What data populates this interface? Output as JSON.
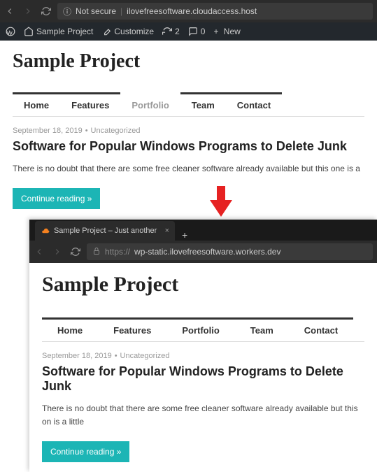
{
  "top": {
    "addressbar": {
      "security_label": "Not secure",
      "url": "ilovefreesoftware.cloudaccess.host"
    },
    "wpbar": {
      "site_name": "Sample Project",
      "customize": "Customize",
      "updates": "2",
      "comments": "0",
      "new": "New"
    },
    "site_title": "Sample Project",
    "nav": [
      {
        "label": "Home",
        "active": true
      },
      {
        "label": "Features",
        "active": true
      },
      {
        "label": "Portfolio",
        "active": false
      },
      {
        "label": "Team",
        "active": true
      },
      {
        "label": "Contact",
        "active": true
      }
    ],
    "post": {
      "date": "September 18, 2019",
      "category": "Uncategorized",
      "title": "Software for Popular Windows Programs to Delete Junk",
      "excerpt": "There is no doubt that there are some free cleaner software already available but this one is a",
      "button": "Continue reading »"
    }
  },
  "bottom": {
    "tab_title": "Sample Project – Just another W",
    "addressbar": {
      "protocol": "https://",
      "url": "wp-static.ilovefreesoftware.workers.dev"
    },
    "site_title": "Sample Project",
    "nav": [
      {
        "label": "Home"
      },
      {
        "label": "Features"
      },
      {
        "label": "Portfolio"
      },
      {
        "label": "Team"
      },
      {
        "label": "Contact"
      }
    ],
    "post": {
      "date": "September 18, 2019",
      "category": "Uncategorized",
      "title": "Software for Popular Windows Programs to Delete Junk",
      "excerpt": "There is no doubt that there are some free cleaner software already available but this on is a little",
      "button": "Continue reading »"
    }
  }
}
